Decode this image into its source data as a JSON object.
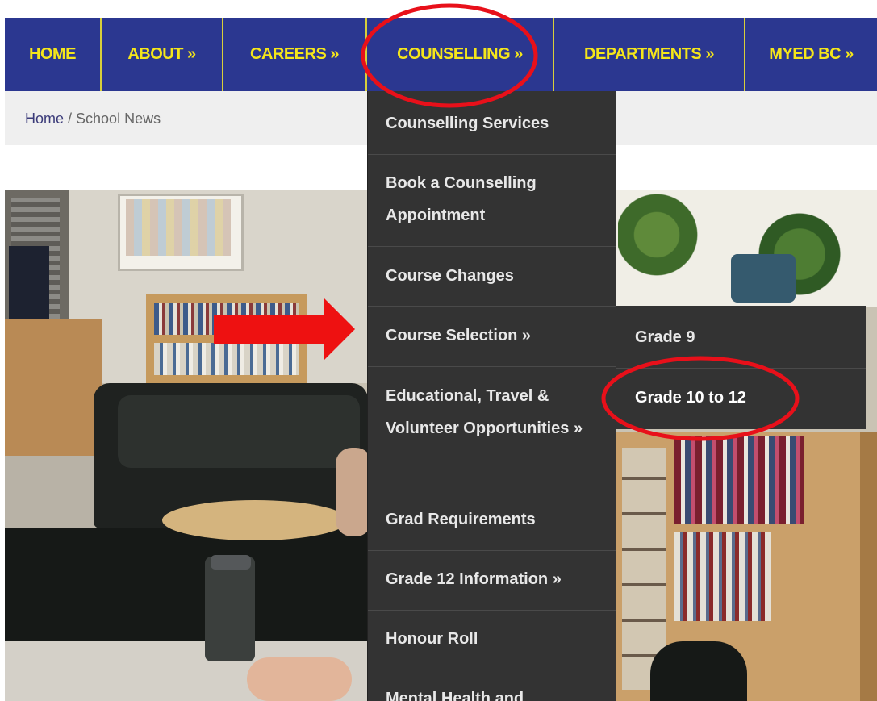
{
  "nav": {
    "items": [
      {
        "label": "HOME"
      },
      {
        "label": "ABOUT »"
      },
      {
        "label": "CAREERS »"
      },
      {
        "label": "COUNSELLING »"
      },
      {
        "label": "DEPARTMENTS »"
      },
      {
        "label": "MYED BC »"
      }
    ]
  },
  "breadcrumb": {
    "home": "Home",
    "separator": " / ",
    "current": "School News"
  },
  "dropdown": {
    "items": [
      {
        "label": "Counselling Services"
      },
      {
        "label": "Book a Counselling Appointment"
      },
      {
        "label": "Course Changes"
      },
      {
        "label": "Course Selection »"
      },
      {
        "label": "Educational, Travel & Volunteer Opportunities »"
      },
      {
        "label": "Grad Requirements"
      },
      {
        "label": "Grade 12 Information »"
      },
      {
        "label": "Honour Roll"
      },
      {
        "label": "Mental Health and"
      }
    ]
  },
  "submenu": {
    "items": [
      {
        "label": "Grade 9"
      },
      {
        "label": "Grade 10 to 12"
      }
    ]
  },
  "colors": {
    "nav_bg": "#2b3790",
    "nav_text": "#f5e61a",
    "menu_bg": "#333333",
    "annotation": "#e8101a"
  }
}
